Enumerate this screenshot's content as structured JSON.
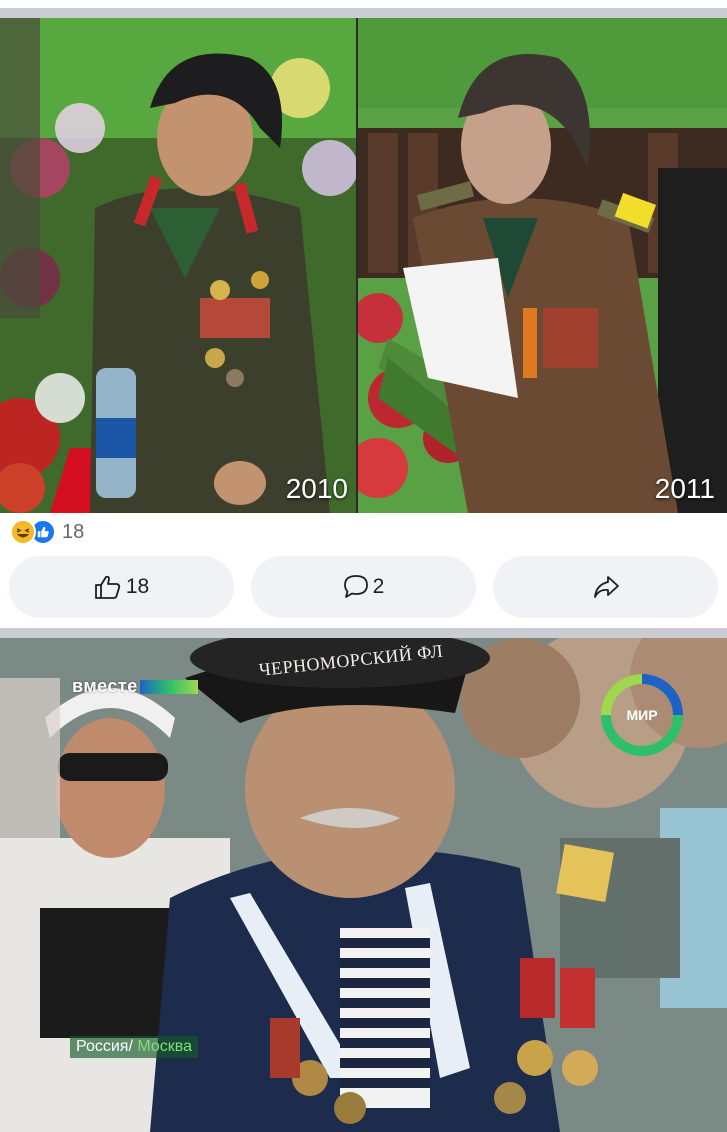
{
  "post1": {
    "photos": [
      {
        "year_label": "2010"
      },
      {
        "year_label": "2011"
      }
    ],
    "reactions": {
      "icons": [
        "haha-icon",
        "like-icon"
      ],
      "count": "18"
    },
    "actions": {
      "like_count": "18",
      "comment_count": "2",
      "share_icon": "share-arrow-icon"
    }
  },
  "post2": {
    "tv_logo": "вместе",
    "channel_logo": "МИР",
    "cap_text": "ЧЕРНОМОРСКИЙ ФЛ",
    "caption_prefix": "Россия/",
    "caption_place": "Москва"
  },
  "colors": {
    "feed_divider": "#c9ccd1",
    "button_bg": "#f0f2f5",
    "like_blue": "#1877f2",
    "haha_yellow": "#f7b928"
  }
}
